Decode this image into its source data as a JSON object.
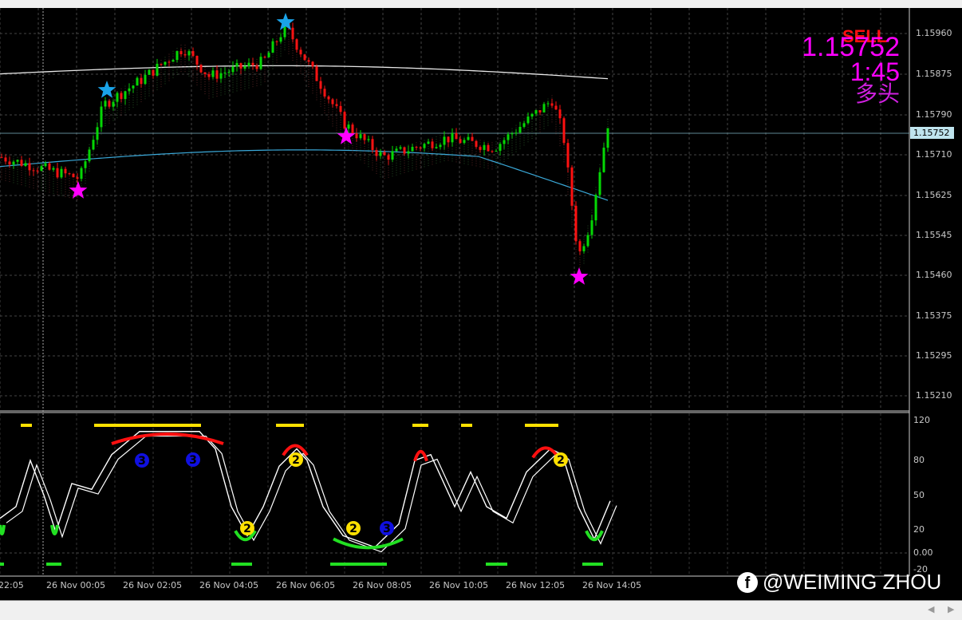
{
  "signal": {
    "action": "SELL",
    "price": "1.15752",
    "time": "1:45",
    "trend": "多头"
  },
  "current_price": "1.15752",
  "price_axis": [
    "1.15960",
    "1.15875",
    "1.15790",
    "1.15710",
    "1.15625",
    "1.15545",
    "1.15460",
    "1.15375",
    "1.15295",
    "1.15210"
  ],
  "indicator_axis": [
    "120",
    "80",
    "50",
    "20",
    "0.00",
    "-20"
  ],
  "time_axis": [
    "22:05",
    "26 Nov 00:05",
    "26 Nov 02:05",
    "26 Nov 04:05",
    "26 Nov 06:05",
    "26 Nov 08:05",
    "26 Nov 10:05",
    "26 Nov 12:05",
    "26 Nov 14:05"
  ],
  "markers": {
    "label_2": "2",
    "label_3": "3"
  },
  "watermark": {
    "icon": "facebook-icon",
    "text": "@WEIMING ZHOU"
  },
  "colors": {
    "bull": "#00e000",
    "bear": "#ff1010",
    "star_buy": "#ff00ff",
    "star_sell": "#1aa3e8",
    "signal": "#ff00ff"
  },
  "price_path": [
    [
      0,
      1.157
    ],
    [
      100,
      1.15655
    ],
    [
      130,
      1.1581
    ],
    [
      175,
      1.1586
    ],
    [
      230,
      1.1593
    ],
    [
      262,
      1.1587
    ],
    [
      330,
      1.159
    ],
    [
      358,
      1.15975
    ],
    [
      385,
      1.159
    ],
    [
      432,
      1.1577
    ],
    [
      480,
      1.157
    ],
    [
      560,
      1.1574
    ],
    [
      620,
      1.1572
    ],
    [
      692,
      1.1582
    ],
    [
      706,
      1.1575
    ],
    [
      725,
      1.1549
    ],
    [
      740,
      1.1556
    ],
    [
      762,
      1.1577
    ]
  ]
}
